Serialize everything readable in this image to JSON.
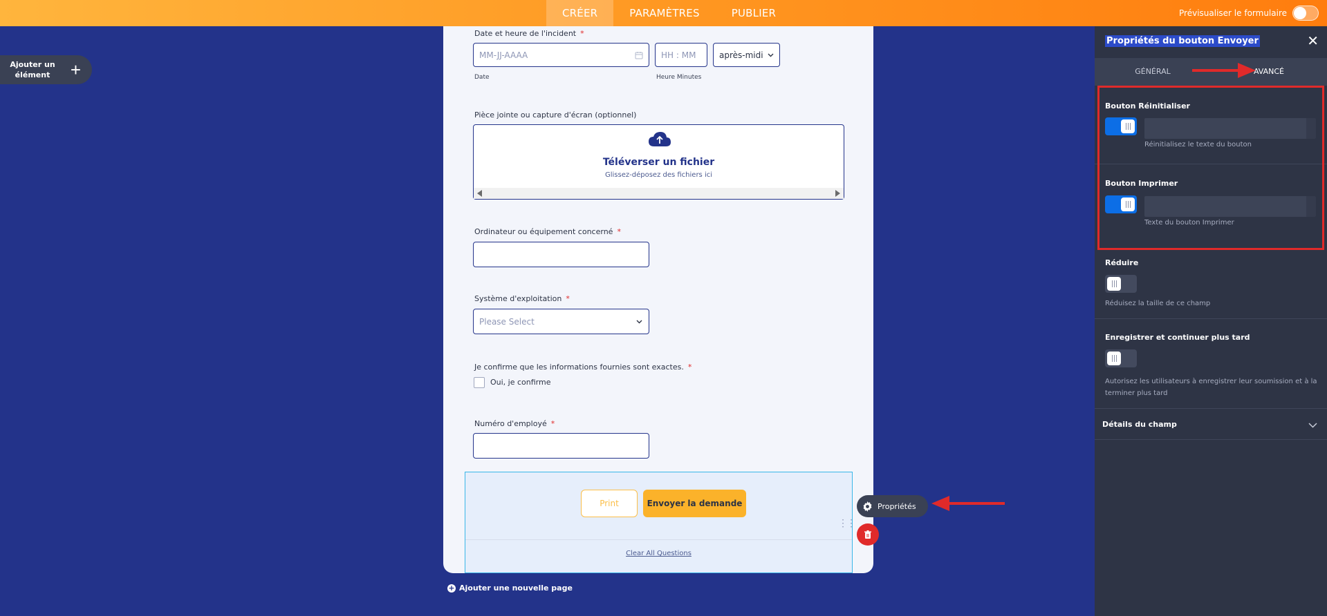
{
  "topbar": {
    "tabs": [
      "CRÉER",
      "PARAMÈTRES",
      "PUBLIER"
    ],
    "preview_label": "Prévisualiser le formulaire"
  },
  "add_element": {
    "label": "Ajouter un élément",
    "plus": "+"
  },
  "form": {
    "date_label": "Date et heure de l'incident",
    "date_placeholder": "MM-JJ-AAAA",
    "time_placeholder": "HH : MM",
    "ampm_value": "après-midi",
    "date_sublabel": "Date",
    "time_sublabel": "Heure Minutes",
    "attachment_label": "Pièce jointe ou capture d'écran (optionnel)",
    "upload_title": "Téléverser un fichier",
    "upload_sub": "Glissez-déposez des fichiers ici",
    "equipment_label": "Ordinateur ou équipement concerné",
    "os_label": "Système d'exploitation",
    "os_placeholder": "Please Select",
    "confirm_label": "Je confirme que les informations fournies sont exactes.",
    "confirm_option": "Oui, je confirme",
    "employee_label": "Numéro d'employé",
    "required_mark": "*",
    "print_button": "Print",
    "send_button": "Envoyer la demande",
    "clear_link": "Clear All Questions",
    "add_page": "Ajouter une nouvelle page",
    "drag_handle": "⋮⋮"
  },
  "properties_pill": {
    "label": "Propriétés"
  },
  "panel": {
    "title": "Propriétés du bouton Envoyer",
    "close": "✕",
    "tabs": [
      "GÉNÉRAL",
      "AVANCÉ"
    ],
    "active_tab": "AVANCÉ",
    "reset": {
      "label": "Bouton Réinitialiser",
      "enabled": true,
      "input_value": "",
      "desc": "Réinitialisez le texte du bouton"
    },
    "print": {
      "label": "Bouton Imprimer",
      "enabled": true,
      "input_value": "",
      "desc": "Texte du bouton Imprimer"
    },
    "shrink": {
      "label": "Réduire",
      "enabled": false,
      "desc": "Réduisez la taille de ce champ"
    },
    "save_later": {
      "label": "Enregistrer et continuer plus tard",
      "enabled": false,
      "desc": "Autorisez les utilisateurs à enregistrer leur soumission et à la terminer plus tard"
    },
    "field_details": {
      "label": "Détails du champ"
    }
  },
  "colors": {
    "background": "#23338a",
    "accent_orange": "#ff9822",
    "button_yellow": "#fbb22a",
    "toggle_on": "#0c6ee6",
    "annotation_red": "#e02a2a",
    "panel_bg": "#2e3445"
  },
  "icons": {
    "calendar": "calendar-icon",
    "upload": "cloud-upload-icon",
    "chevron": "chevron-down-icon",
    "gear": "gear-icon",
    "trash": "trash-icon",
    "plus_circle": "plus-circle-icon"
  }
}
